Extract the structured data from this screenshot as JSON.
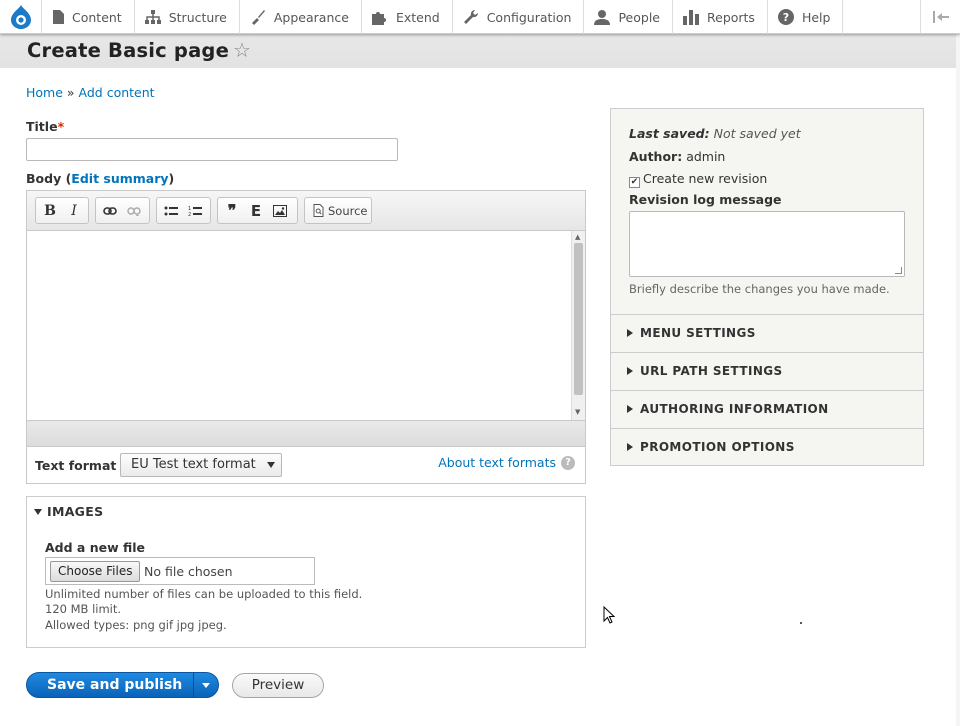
{
  "toolbar": {
    "items": [
      {
        "label": "Content",
        "icon": "file-icon"
      },
      {
        "label": "Structure",
        "icon": "sitemap-icon"
      },
      {
        "label": "Appearance",
        "icon": "paintbrush-icon"
      },
      {
        "label": "Extend",
        "icon": "puzzle-icon"
      },
      {
        "label": "Configuration",
        "icon": "wrench-icon"
      },
      {
        "label": "People",
        "icon": "person-icon"
      },
      {
        "label": "Reports",
        "icon": "bar-chart-icon"
      },
      {
        "label": "Help",
        "icon": "help-icon"
      }
    ]
  },
  "page": {
    "title": "Create Basic page",
    "breadcrumb": {
      "home": "Home",
      "sep": " » ",
      "add_content": "Add content"
    }
  },
  "form": {
    "title_label": "Title",
    "required_mark": "*",
    "body_label": "Body",
    "body_paren_open": "(",
    "edit_summary": "Edit summary",
    "body_paren_close": ")",
    "editor": {
      "buttons": {
        "bold": "B",
        "italic": "I",
        "blockquote": "❞",
        "embed": "E",
        "source": "Source"
      }
    },
    "text_format": {
      "label": "Text format",
      "selected": "EU Test text format",
      "about": "About text formats"
    },
    "images": {
      "legend": "IMAGES",
      "add_label": "Add a new file",
      "choose_button": "Choose Files",
      "no_file": "No file chosen",
      "desc1": "Unlimited number of files can be uploaded to this field.",
      "desc2": "120 MB limit.",
      "desc3": "Allowed types: png gif jpg jpeg."
    },
    "actions": {
      "save": "Save and publish",
      "preview": "Preview"
    }
  },
  "sidebar": {
    "last_saved_label": "Last saved:",
    "last_saved_value": "Not saved yet",
    "author_label": "Author:",
    "author_value": "admin",
    "new_revision_label": "Create new revision",
    "new_revision_checked": true,
    "revision_log_label": "Revision log message",
    "revision_hint": "Briefly describe the changes you have made.",
    "sections": [
      {
        "label": "MENU SETTINGS"
      },
      {
        "label": "URL PATH SETTINGS"
      },
      {
        "label": "AUTHORING INFORMATION"
      },
      {
        "label": "PROMOTION OPTIONS"
      }
    ]
  },
  "colors": {
    "link": "#0074bd",
    "primary_button": "#0a63b8",
    "required": "#e32700"
  }
}
